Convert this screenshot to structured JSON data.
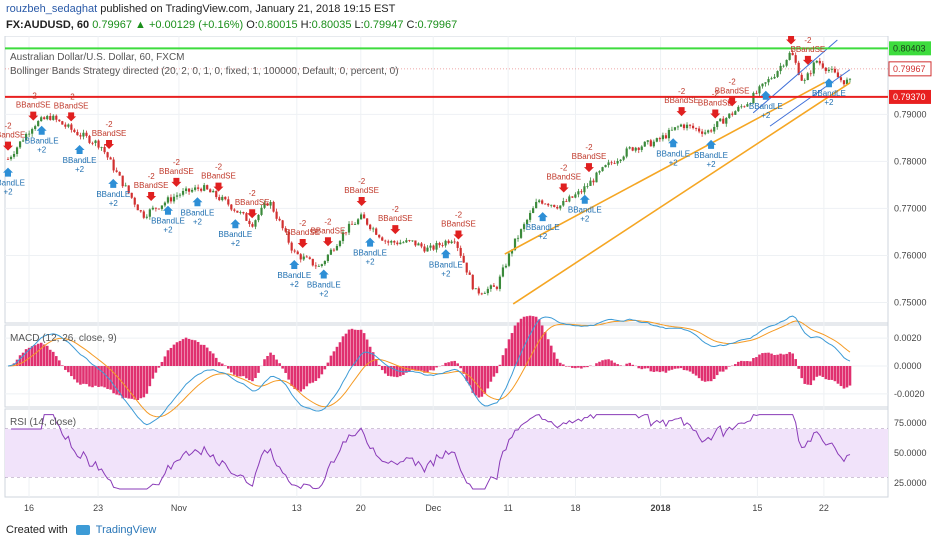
{
  "header": {
    "username": "rouzbeh_sedaghat",
    "published_text": "published on TradingView.com, January 21, 2018 19:15 EST",
    "symbol": "FX:AUDUSD, 60",
    "last": "0.79967",
    "change": "▲ +0.00129 (+0.16%)",
    "o_label": "O:",
    "o": "0.80015",
    "h_label": "H:",
    "h": "0.80035",
    "l_label": "L:",
    "l": "0.79947",
    "c_label": "C:",
    "c": "0.79967"
  },
  "legend": {
    "instrument": "Australian Dollar/U.S. Dollar, 60, FXCM",
    "strategy": "Bollinger Bands Strategy directed (20, 2, 0, 1, 0, fixed, 1, 100000, Default, 0, percent, 0)"
  },
  "signals": {
    "sell_label": "BBandSE",
    "sell_qty": "-2",
    "buy_label": "BBandLE",
    "buy_qty": "+2"
  },
  "price_labels": {
    "upper": "0.80403",
    "current": "0.79967",
    "lower": "0.79370"
  },
  "footer": {
    "created_with": "Created with",
    "brand": "TradingView"
  },
  "colors": {
    "up_candle": "#3b8a3b",
    "down_candle": "#d13030",
    "green_line": "#3ddc3d",
    "red_line": "#e82020",
    "channel": "#f5a623",
    "inner_channel": "#3f6fd8",
    "macd": "#3d9bd6",
    "signal": "#f59a23",
    "histogram": "#e0306f",
    "rsi": "#8a3bb8",
    "rsi_band": "#f1e3fa"
  },
  "chart_data": [
    {
      "type": "candlestick",
      "title": "Australian Dollar/U.S. Dollar, 60, FXCM",
      "y_ticks": [
        "0.79000",
        "0.78000",
        "0.77000",
        "0.76000",
        "0.75000"
      ],
      "ylim": [
        0.7465,
        0.8058
      ],
      "x_ticks": [
        "16",
        "23",
        "Nov",
        "13",
        "20",
        "Dec",
        "11",
        "18",
        "2018",
        "15",
        "22"
      ],
      "x_tick_pos": [
        0.025,
        0.107,
        0.203,
        0.343,
        0.419,
        0.505,
        0.594,
        0.674,
        0.775,
        0.89,
        0.969
      ],
      "series_anchors": {
        "t": [
          0.0,
          0.03,
          0.05,
          0.08,
          0.11,
          0.13,
          0.16,
          0.2,
          0.23,
          0.26,
          0.29,
          0.31,
          0.34,
          0.37,
          0.4,
          0.42,
          0.45,
          0.48,
          0.5,
          0.53,
          0.555,
          0.58,
          0.6,
          0.63,
          0.655,
          0.68,
          0.71,
          0.74,
          0.77,
          0.8,
          0.83,
          0.86,
          0.88,
          0.91,
          0.93,
          0.945,
          0.96,
          0.975,
          0.99,
          1.0
        ],
        "price": [
          0.7805,
          0.7878,
          0.7895,
          0.7862,
          0.7835,
          0.7772,
          0.7685,
          0.7728,
          0.7745,
          0.7712,
          0.7668,
          0.7717,
          0.7605,
          0.7575,
          0.7652,
          0.7681,
          0.7628,
          0.7628,
          0.7612,
          0.7639,
          0.7522,
          0.7532,
          0.7622,
          0.7718,
          0.7705,
          0.7735,
          0.7788,
          0.7828,
          0.7842,
          0.7878,
          0.7862,
          0.7902,
          0.7928,
          0.7985,
          0.8032,
          0.7965,
          0.8015,
          0.7995,
          0.7972,
          0.7968
        ]
      },
      "horizontal_lines": [
        {
          "name": "upper",
          "value": 0.80403,
          "label": "0.80403"
        },
        {
          "name": "current",
          "value": 0.79967,
          "label": "0.79967"
        },
        {
          "name": "lower",
          "value": 0.7937,
          "label": "0.79370"
        }
      ],
      "channel_lines": [
        {
          "name": "channel-upper",
          "from": [
            0.59,
            0.7603
          ],
          "to": [
            0.97,
            0.7968
          ]
        },
        {
          "name": "channel-lower",
          "from": [
            0.6,
            0.7497
          ],
          "to": [
            1.0,
            0.7967
          ]
        },
        {
          "name": "inner-upper",
          "from": [
            0.885,
            0.7903
          ],
          "to": [
            0.985,
            0.8058
          ]
        },
        {
          "name": "inner-lower",
          "from": [
            0.905,
            0.7875
          ],
          "to": [
            1.0,
            0.7995
          ]
        }
      ],
      "sell_signals_t": [
        0.0,
        0.03,
        0.075,
        0.12,
        0.17,
        0.2,
        0.25,
        0.29,
        0.35,
        0.38,
        0.42,
        0.46,
        0.535,
        0.66,
        0.69,
        0.8,
        0.84,
        0.86,
        0.93,
        0.95
      ],
      "buy_signals_t": [
        0.0,
        0.04,
        0.085,
        0.125,
        0.19,
        0.225,
        0.27,
        0.34,
        0.375,
        0.43,
        0.52,
        0.635,
        0.685,
        0.79,
        0.835,
        0.9,
        0.975
      ]
    },
    {
      "type": "line",
      "title": "MACD (12, 26, close, 9)",
      "series": [
        {
          "name": "MACD",
          "values": []
        },
        {
          "name": "Signal",
          "values": []
        },
        {
          "name": "Histogram",
          "values": []
        }
      ],
      "y_ticks": [
        "0.0020",
        "0.0000",
        "-0.0020"
      ],
      "ylim": [
        -0.0028,
        0.0028
      ]
    },
    {
      "type": "line",
      "title": "RSI (14, close)",
      "series": [
        {
          "name": "RSI",
          "values": []
        }
      ],
      "y_ticks": [
        "75.0000",
        "50.0000",
        "25.0000"
      ],
      "bands": [
        30,
        70
      ],
      "ylim": [
        15,
        85
      ]
    }
  ]
}
